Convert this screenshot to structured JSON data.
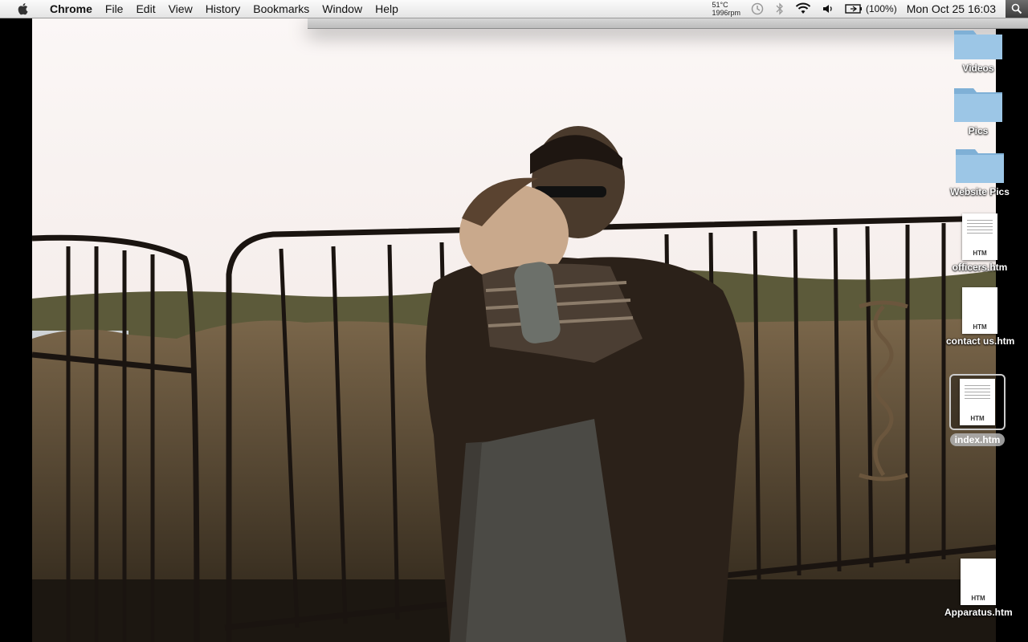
{
  "menubar": {
    "app_name": "Chrome",
    "items": [
      "File",
      "Edit",
      "View",
      "History",
      "Bookmarks",
      "Window",
      "Help"
    ],
    "status": {
      "temperature": "51°C",
      "fan": "1996rpm",
      "battery": "(100%)",
      "clock": "Mon Oct 25  16:03"
    }
  },
  "desktop": {
    "icons": [
      {
        "label": "Videos",
        "kind": "folder"
      },
      {
        "label": "Pics",
        "kind": "folder"
      },
      {
        "label": "Website Pics",
        "kind": "folder"
      },
      {
        "label": "officers.htm",
        "kind": "file",
        "type": "HTM"
      },
      {
        "label": "contact us.htm",
        "kind": "file",
        "type": "HTM"
      },
      {
        "label": "index.htm",
        "kind": "file",
        "type": "HTM",
        "selected": true
      },
      {
        "label": "Apparatus.htm",
        "kind": "file",
        "type": "HTM"
      }
    ]
  }
}
